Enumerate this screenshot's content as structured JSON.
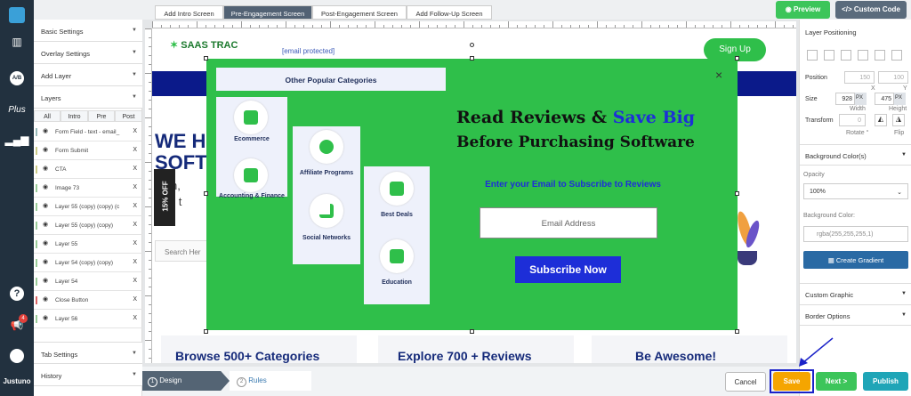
{
  "brand": {
    "rail_label": "Justuno",
    "badge": "4"
  },
  "screen_tabs": [
    "Add Intro Screen",
    "Pre-Engagement Screen",
    "Post-Engagement Screen",
    "Add Follow-Up Screen"
  ],
  "top_buttons": {
    "preview": "Preview",
    "custom_code": "Custom Code"
  },
  "left_panel": {
    "sections": [
      "Basic Settings",
      "Overlay Settings",
      "Add Layer",
      "Layers"
    ],
    "layer_tabs": [
      "All",
      "Intro",
      "Pre",
      "Post"
    ],
    "layers": [
      {
        "name": "Form Field - text - email_",
        "color": "#9bb"
      },
      {
        "name": "Form Submit",
        "color": "#cc8"
      },
      {
        "name": "CTA",
        "color": "#cc8"
      },
      {
        "name": "Image 73",
        "color": "#9c9"
      },
      {
        "name": "Layer 55 (copy) (copy) (c",
        "color": "#9c9"
      },
      {
        "name": "Layer 55 (copy) (copy)",
        "color": "#9c9"
      },
      {
        "name": "Layer 55",
        "color": "#9c9"
      },
      {
        "name": "Layer 54 (copy) (copy)",
        "color": "#9c9"
      },
      {
        "name": "Layer 54",
        "color": "#9c9"
      },
      {
        "name": "Close Button",
        "color": "#d66"
      },
      {
        "name": "Layer 56",
        "color": "#9c9"
      }
    ],
    "layer_close": "X",
    "bottom_sections": [
      "Tab Settings",
      "History"
    ]
  },
  "site": {
    "logo": "SAAS TRAC",
    "email_link": "[email protected]",
    "signup": "Sign Up",
    "hero_text": "WE H\nSOFT",
    "hero_sub": "arch,\nvice t",
    "search_placeholder": "Search Her",
    "bottom_headings": [
      "Browse 500+ Categories",
      "Explore 700 + Reviews",
      "Be Awesome!"
    ],
    "side_tab": "15% OFF"
  },
  "popup": {
    "categories_title": "Other Popular Categories",
    "cards": [
      "Ecommerce",
      "Accounting & Finance",
      "Affiliate Programs",
      "Social Networks",
      "Best Deals",
      "Education"
    ],
    "headline_1": "Read Reviews  & ",
    "headline_highlight": "Save Big",
    "headline_2": "Before Purchasing Software",
    "subhead": "Enter your Email to Subscribe to Reviews",
    "email_placeholder": "Email Address",
    "submit": "Subscribe Now",
    "close": "×",
    "colors": {
      "bg": "#2fbf4a",
      "submit": "#1d2ed8",
      "highlight": "#1d2ed8"
    }
  },
  "right_panel": {
    "layer_positioning": "Layer Positioning",
    "position_label": "Position",
    "pos_x": "150",
    "pos_y": "100",
    "x_label": "X",
    "y_label": "Y",
    "size_label": "Size",
    "width": "928",
    "height": "475",
    "px": "PX",
    "width_label": "Width",
    "height_label": "Height",
    "transform_label": "Transform",
    "rotate": "0",
    "rotate_label": "Rotate °",
    "flip_label": "Flip",
    "background_colors": "Background Color(s)",
    "opacity_label": "Opacity",
    "opacity_value": "100%",
    "bg_color_label": "Background Color:",
    "bg_color_value": "rgba(255,255,255,1)",
    "create_gradient": "Create Gradient",
    "custom_graphic": "Custom Graphic",
    "border_options": "Border Options"
  },
  "bottom": {
    "steps": [
      {
        "num": "1",
        "label": "Design"
      },
      {
        "num": "2",
        "label": "Rules"
      }
    ],
    "cancel": "Cancel",
    "save": "Save",
    "next": "Next >",
    "publish": "Publish"
  }
}
